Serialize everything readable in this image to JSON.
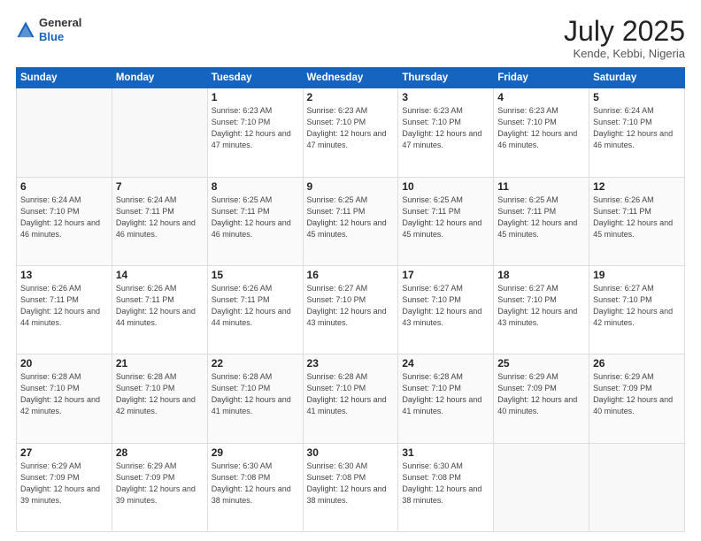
{
  "logo": {
    "general": "General",
    "blue": "Blue"
  },
  "header": {
    "month": "July 2025",
    "location": "Kende, Kebbi, Nigeria"
  },
  "weekdays": [
    "Sunday",
    "Monday",
    "Tuesday",
    "Wednesday",
    "Thursday",
    "Friday",
    "Saturday"
  ],
  "weeks": [
    [
      {
        "day": "",
        "empty": true
      },
      {
        "day": "",
        "empty": true
      },
      {
        "day": "1",
        "sunrise": "Sunrise: 6:23 AM",
        "sunset": "Sunset: 7:10 PM",
        "daylight": "Daylight: 12 hours and 47 minutes."
      },
      {
        "day": "2",
        "sunrise": "Sunrise: 6:23 AM",
        "sunset": "Sunset: 7:10 PM",
        "daylight": "Daylight: 12 hours and 47 minutes."
      },
      {
        "day": "3",
        "sunrise": "Sunrise: 6:23 AM",
        "sunset": "Sunset: 7:10 PM",
        "daylight": "Daylight: 12 hours and 47 minutes."
      },
      {
        "day": "4",
        "sunrise": "Sunrise: 6:23 AM",
        "sunset": "Sunset: 7:10 PM",
        "daylight": "Daylight: 12 hours and 46 minutes."
      },
      {
        "day": "5",
        "sunrise": "Sunrise: 6:24 AM",
        "sunset": "Sunset: 7:10 PM",
        "daylight": "Daylight: 12 hours and 46 minutes."
      }
    ],
    [
      {
        "day": "6",
        "sunrise": "Sunrise: 6:24 AM",
        "sunset": "Sunset: 7:10 PM",
        "daylight": "Daylight: 12 hours and 46 minutes."
      },
      {
        "day": "7",
        "sunrise": "Sunrise: 6:24 AM",
        "sunset": "Sunset: 7:11 PM",
        "daylight": "Daylight: 12 hours and 46 minutes."
      },
      {
        "day": "8",
        "sunrise": "Sunrise: 6:25 AM",
        "sunset": "Sunset: 7:11 PM",
        "daylight": "Daylight: 12 hours and 46 minutes."
      },
      {
        "day": "9",
        "sunrise": "Sunrise: 6:25 AM",
        "sunset": "Sunset: 7:11 PM",
        "daylight": "Daylight: 12 hours and 45 minutes."
      },
      {
        "day": "10",
        "sunrise": "Sunrise: 6:25 AM",
        "sunset": "Sunset: 7:11 PM",
        "daylight": "Daylight: 12 hours and 45 minutes."
      },
      {
        "day": "11",
        "sunrise": "Sunrise: 6:25 AM",
        "sunset": "Sunset: 7:11 PM",
        "daylight": "Daylight: 12 hours and 45 minutes."
      },
      {
        "day": "12",
        "sunrise": "Sunrise: 6:26 AM",
        "sunset": "Sunset: 7:11 PM",
        "daylight": "Daylight: 12 hours and 45 minutes."
      }
    ],
    [
      {
        "day": "13",
        "sunrise": "Sunrise: 6:26 AM",
        "sunset": "Sunset: 7:11 PM",
        "daylight": "Daylight: 12 hours and 44 minutes."
      },
      {
        "day": "14",
        "sunrise": "Sunrise: 6:26 AM",
        "sunset": "Sunset: 7:11 PM",
        "daylight": "Daylight: 12 hours and 44 minutes."
      },
      {
        "day": "15",
        "sunrise": "Sunrise: 6:26 AM",
        "sunset": "Sunset: 7:11 PM",
        "daylight": "Daylight: 12 hours and 44 minutes."
      },
      {
        "day": "16",
        "sunrise": "Sunrise: 6:27 AM",
        "sunset": "Sunset: 7:10 PM",
        "daylight": "Daylight: 12 hours and 43 minutes."
      },
      {
        "day": "17",
        "sunrise": "Sunrise: 6:27 AM",
        "sunset": "Sunset: 7:10 PM",
        "daylight": "Daylight: 12 hours and 43 minutes."
      },
      {
        "day": "18",
        "sunrise": "Sunrise: 6:27 AM",
        "sunset": "Sunset: 7:10 PM",
        "daylight": "Daylight: 12 hours and 43 minutes."
      },
      {
        "day": "19",
        "sunrise": "Sunrise: 6:27 AM",
        "sunset": "Sunset: 7:10 PM",
        "daylight": "Daylight: 12 hours and 42 minutes."
      }
    ],
    [
      {
        "day": "20",
        "sunrise": "Sunrise: 6:28 AM",
        "sunset": "Sunset: 7:10 PM",
        "daylight": "Daylight: 12 hours and 42 minutes."
      },
      {
        "day": "21",
        "sunrise": "Sunrise: 6:28 AM",
        "sunset": "Sunset: 7:10 PM",
        "daylight": "Daylight: 12 hours and 42 minutes."
      },
      {
        "day": "22",
        "sunrise": "Sunrise: 6:28 AM",
        "sunset": "Sunset: 7:10 PM",
        "daylight": "Daylight: 12 hours and 41 minutes."
      },
      {
        "day": "23",
        "sunrise": "Sunrise: 6:28 AM",
        "sunset": "Sunset: 7:10 PM",
        "daylight": "Daylight: 12 hours and 41 minutes."
      },
      {
        "day": "24",
        "sunrise": "Sunrise: 6:28 AM",
        "sunset": "Sunset: 7:10 PM",
        "daylight": "Daylight: 12 hours and 41 minutes."
      },
      {
        "day": "25",
        "sunrise": "Sunrise: 6:29 AM",
        "sunset": "Sunset: 7:09 PM",
        "daylight": "Daylight: 12 hours and 40 minutes."
      },
      {
        "day": "26",
        "sunrise": "Sunrise: 6:29 AM",
        "sunset": "Sunset: 7:09 PM",
        "daylight": "Daylight: 12 hours and 40 minutes."
      }
    ],
    [
      {
        "day": "27",
        "sunrise": "Sunrise: 6:29 AM",
        "sunset": "Sunset: 7:09 PM",
        "daylight": "Daylight: 12 hours and 39 minutes."
      },
      {
        "day": "28",
        "sunrise": "Sunrise: 6:29 AM",
        "sunset": "Sunset: 7:09 PM",
        "daylight": "Daylight: 12 hours and 39 minutes."
      },
      {
        "day": "29",
        "sunrise": "Sunrise: 6:30 AM",
        "sunset": "Sunset: 7:08 PM",
        "daylight": "Daylight: 12 hours and 38 minutes."
      },
      {
        "day": "30",
        "sunrise": "Sunrise: 6:30 AM",
        "sunset": "Sunset: 7:08 PM",
        "daylight": "Daylight: 12 hours and 38 minutes."
      },
      {
        "day": "31",
        "sunrise": "Sunrise: 6:30 AM",
        "sunset": "Sunset: 7:08 PM",
        "daylight": "Daylight: 12 hours and 38 minutes."
      },
      {
        "day": "",
        "empty": true
      },
      {
        "day": "",
        "empty": true
      }
    ]
  ]
}
